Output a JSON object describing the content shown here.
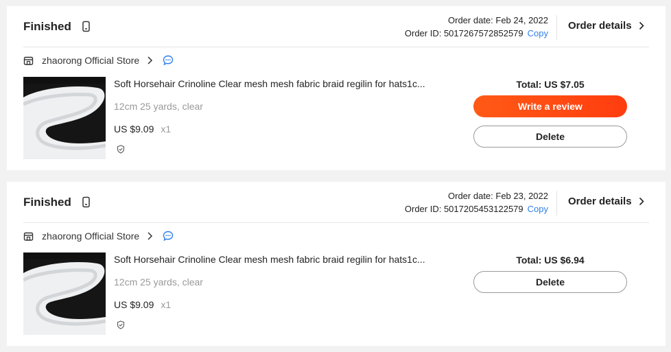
{
  "orders": [
    {
      "status": "Finished",
      "order_date": "Order date: Feb 24, 2022",
      "order_id": "Order ID: 5017267572852579",
      "copy": "Copy",
      "details": "Order details",
      "store": "zhaorong Official Store",
      "title": "Soft Horsehair Crinoline Clear mesh mesh fabric braid regilin for hats1c...",
      "variant": "12cm 25 yards, clear",
      "price": "US $9.09",
      "qty": "x1",
      "total": "Total: US $7.05",
      "review": "Write a review",
      "delete": "Delete"
    },
    {
      "status": "Finished",
      "order_date": "Order date: Feb 23, 2022",
      "order_id": "Order ID: 5017205453122579",
      "copy": "Copy",
      "details": "Order details",
      "store": "zhaorong Official Store",
      "title": "Soft Horsehair Crinoline Clear mesh mesh fabric braid regilin for hats1c...",
      "variant": "12cm 25 yards, clear",
      "price": "US $9.09",
      "qty": "x1",
      "total": "Total: US $6.94",
      "delete": "Delete"
    }
  ],
  "colors": {
    "accent": "#ff4b12",
    "link": "#2e7fe8"
  }
}
